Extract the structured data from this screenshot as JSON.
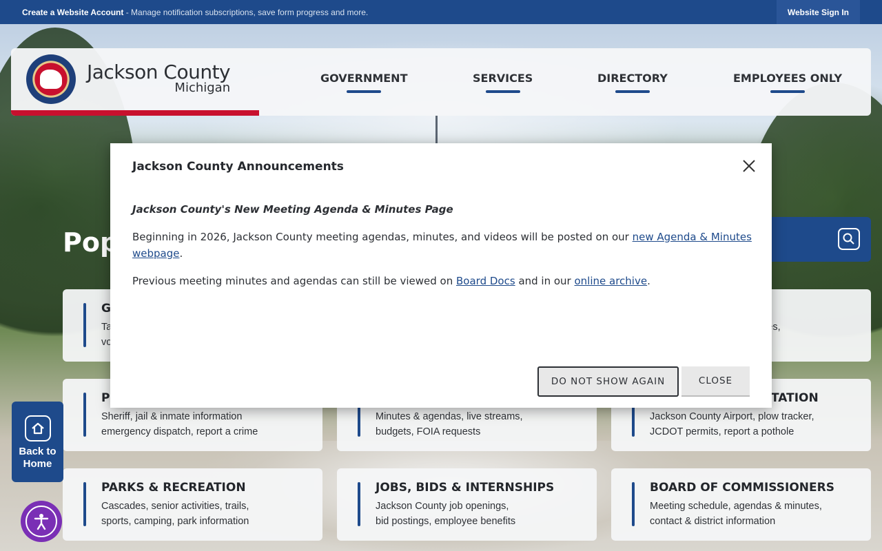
{
  "topbar": {
    "promo_bold": "Create a Website Account",
    "promo_rest": " - Manage notification subscriptions, save form progress and more.",
    "signin_label": "Website Sign In"
  },
  "header": {
    "county_name": "Jackson County",
    "state_name": "Michigan",
    "nav": [
      "GOVERNMENT",
      "SERVICES",
      "DIRECTORY",
      "EMPLOYEES ONLY"
    ]
  },
  "popular_heading_partial": "Pop",
  "tiles": [
    {
      "title": "G",
      "desc": "Ta\nvo"
    },
    {
      "title": "",
      "desc": "erk fees,"
    },
    {
      "title": "P",
      "desc": "Sheriff, jail & inmate information\nemergency dispatch, report a crime"
    },
    {
      "title": "",
      "desc": "Minutes & agendas, live streams,\nbudgets, FOIA requests"
    },
    {
      "title": "TATION",
      "desc": "Jackson County Airport, plow tracker,\nJCDOT permits, report a pothole"
    },
    {
      "title": "PARKS & RECREATION",
      "desc": "Cascades, senior activities, trails,\nsports, camping, park information"
    },
    {
      "title": "JOBS, BIDS & INTERNSHIPS",
      "desc": "Jackson County job openings,\nbid postings, employee benefits"
    },
    {
      "title": "BOARD OF COMMISSIONERS",
      "desc": "Meeting schedule, agendas & minutes,\ncontact & district information"
    }
  ],
  "back_home": {
    "line1": "Back to",
    "line2": "Home"
  },
  "modal": {
    "title": "Jackson County Announcements",
    "subtitle": "Jackson County's New Meeting Agenda & Minutes Page",
    "p1_text": "Beginning in 2026, Jackson County meeting agendas, minutes, and videos will be posted on our ",
    "p1_link": "new Agenda & Minutes webpage",
    "p1_end": ".",
    "p2_text": "Previous meeting minutes and agendas can still be viewed on ",
    "p2_link1": "Board Docs",
    "p2_mid": " and in our ",
    "p2_link2": "online archive",
    "p2_end": ".",
    "btn_do_not_show": "DO NOT SHOW AGAIN",
    "btn_close": "CLOSE"
  },
  "colors": {
    "primary": "#1e4a8b",
    "accent_red": "#c8102e",
    "a11y_purple": "#7a2fb5"
  },
  "icons": [
    "close-icon",
    "search-icon",
    "home-icon",
    "accessibility-icon",
    "county-seal-logo"
  ]
}
